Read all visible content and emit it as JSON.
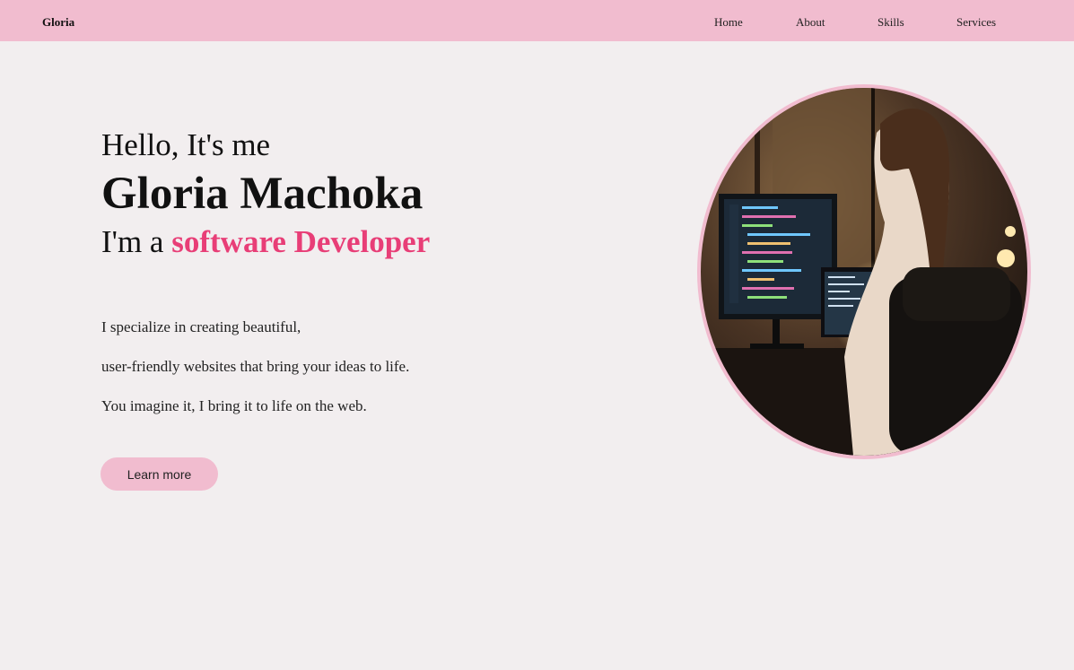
{
  "navbar": {
    "brand": "Gloria",
    "links": [
      {
        "label": "Home"
      },
      {
        "label": "About"
      },
      {
        "label": "Skills"
      },
      {
        "label": "Services"
      }
    ]
  },
  "hero": {
    "greeting": "Hello, It's me",
    "name": "Gloria Machoka",
    "role_prefix": "I'm a ",
    "role_highlight": "software Developer",
    "description": [
      "I specialize in creating beautiful,",
      "user-friendly websites that bring your ideas to life.",
      "You imagine it, I bring it to life on the web."
    ],
    "button_label": "Learn more"
  },
  "colors": {
    "navbar_bg": "#f1bccf",
    "page_bg": "#f2eeef",
    "accent": "#e83e77"
  }
}
